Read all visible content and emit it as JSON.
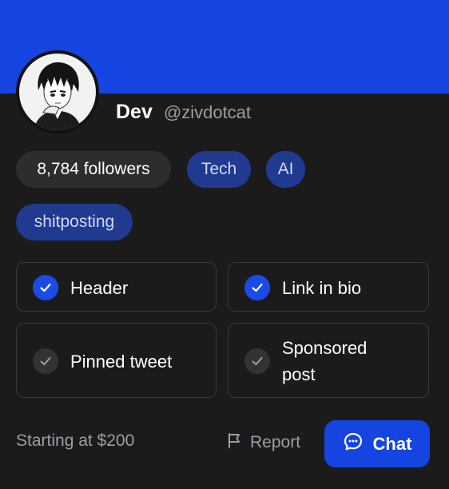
{
  "profile": {
    "display_name": "Dev",
    "handle": "@zivdotcat",
    "avatar": "anime-avatar"
  },
  "tags": {
    "followers": "8,784 followers",
    "items": [
      "Tech",
      "AI",
      "shitposting"
    ]
  },
  "features": [
    {
      "label": "Header",
      "checked": true
    },
    {
      "label": "Link in bio",
      "checked": true
    },
    {
      "label": "Pinned tweet",
      "checked": false
    },
    {
      "label": "Sponsored",
      "label_line2": "post",
      "checked": false
    }
  ],
  "footer": {
    "price": "Starting at $200",
    "report_label": "Report",
    "chat_label": "Chat"
  },
  "colors": {
    "accent": "#1544e0",
    "check_on": "#1a4be6",
    "tag_bg": "#1f3a8f",
    "card_bg": "#1b1b1c"
  },
  "icons": {
    "check": "check-icon",
    "report": "flag-icon",
    "chat": "chat-bubble-icon"
  }
}
